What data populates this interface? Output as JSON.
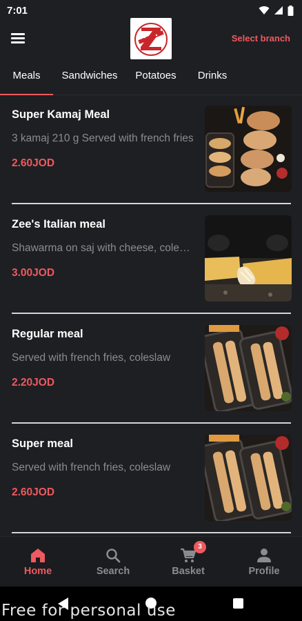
{
  "status_bar": {
    "time": "7:01"
  },
  "header": {
    "select_branch_label": "Select branch",
    "logo_icon": "restaurant-logo"
  },
  "tabs": [
    {
      "label": "Meals",
      "active": true
    },
    {
      "label": "Sandwiches",
      "active": false
    },
    {
      "label": "Potatoes",
      "active": false
    },
    {
      "label": "Drinks",
      "active": false
    }
  ],
  "meals": [
    {
      "name": "Super Kamaj Meal",
      "description": "3 kamaj 210 g Served with french fries",
      "price": "2.60JOD"
    },
    {
      "name": "Zee's Italian meal",
      "description": "Shawarma on saj with cheese, coleslaw",
      "price": "3.00JOD"
    },
    {
      "name": "Regular meal",
      "description": "Served with french fries, coleslaw",
      "price": "2.20JOD"
    },
    {
      "name": "Super meal",
      "description": "Served with french fries, coleslaw",
      "price": "2.60JOD"
    }
  ],
  "bottom_nav": [
    {
      "label": "Home",
      "icon": "home-icon",
      "active": true
    },
    {
      "label": "Search",
      "icon": "search-icon",
      "active": false
    },
    {
      "label": "Basket",
      "icon": "basket-icon",
      "active": false,
      "badge": "3"
    },
    {
      "label": "Profile",
      "icon": "profile-icon",
      "active": false
    }
  ],
  "watermark": "Free for personal use",
  "colors": {
    "accent": "#ee5a5f",
    "background": "#1e1f23",
    "muted_text": "#8b8c90"
  }
}
